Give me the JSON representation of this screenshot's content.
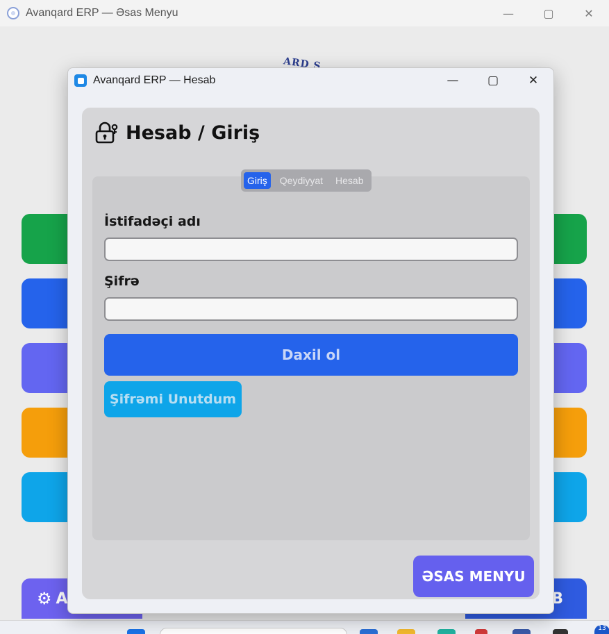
{
  "background_window": {
    "title": "Avanqard ERP — Əsas Menyu",
    "logo_text": "ARD S",
    "bottom_left_label": "A",
    "bottom_right_label": "B",
    "button_colors": [
      "#16a34a",
      "#2563eb",
      "#6366f1",
      "#f59e0b",
      "#0ea5e9"
    ]
  },
  "dialog": {
    "title": "Avanqard ERP — Hesab",
    "heading": "Hesab / Giriş",
    "tabs": [
      {
        "label": "Giriş",
        "active": true
      },
      {
        "label": "Qeydiyyat",
        "active": false
      },
      {
        "label": "Hesab",
        "active": false
      }
    ],
    "username": {
      "label": "İstifadəçi adı",
      "value": "",
      "placeholder": ""
    },
    "password": {
      "label": "Şifrə",
      "value": "",
      "placeholder": ""
    },
    "login_button": "Daxil ol",
    "forgot_button": "Şifrəmi Unutdum",
    "main_menu_button": "ƏSAS MENYU"
  },
  "colors": {
    "primary": "#2563eb",
    "info": "#0ea5e9",
    "accent": "#6560ee",
    "success": "#16a34a",
    "warning": "#f59e0b"
  },
  "taskbar": {
    "badge": "13"
  }
}
